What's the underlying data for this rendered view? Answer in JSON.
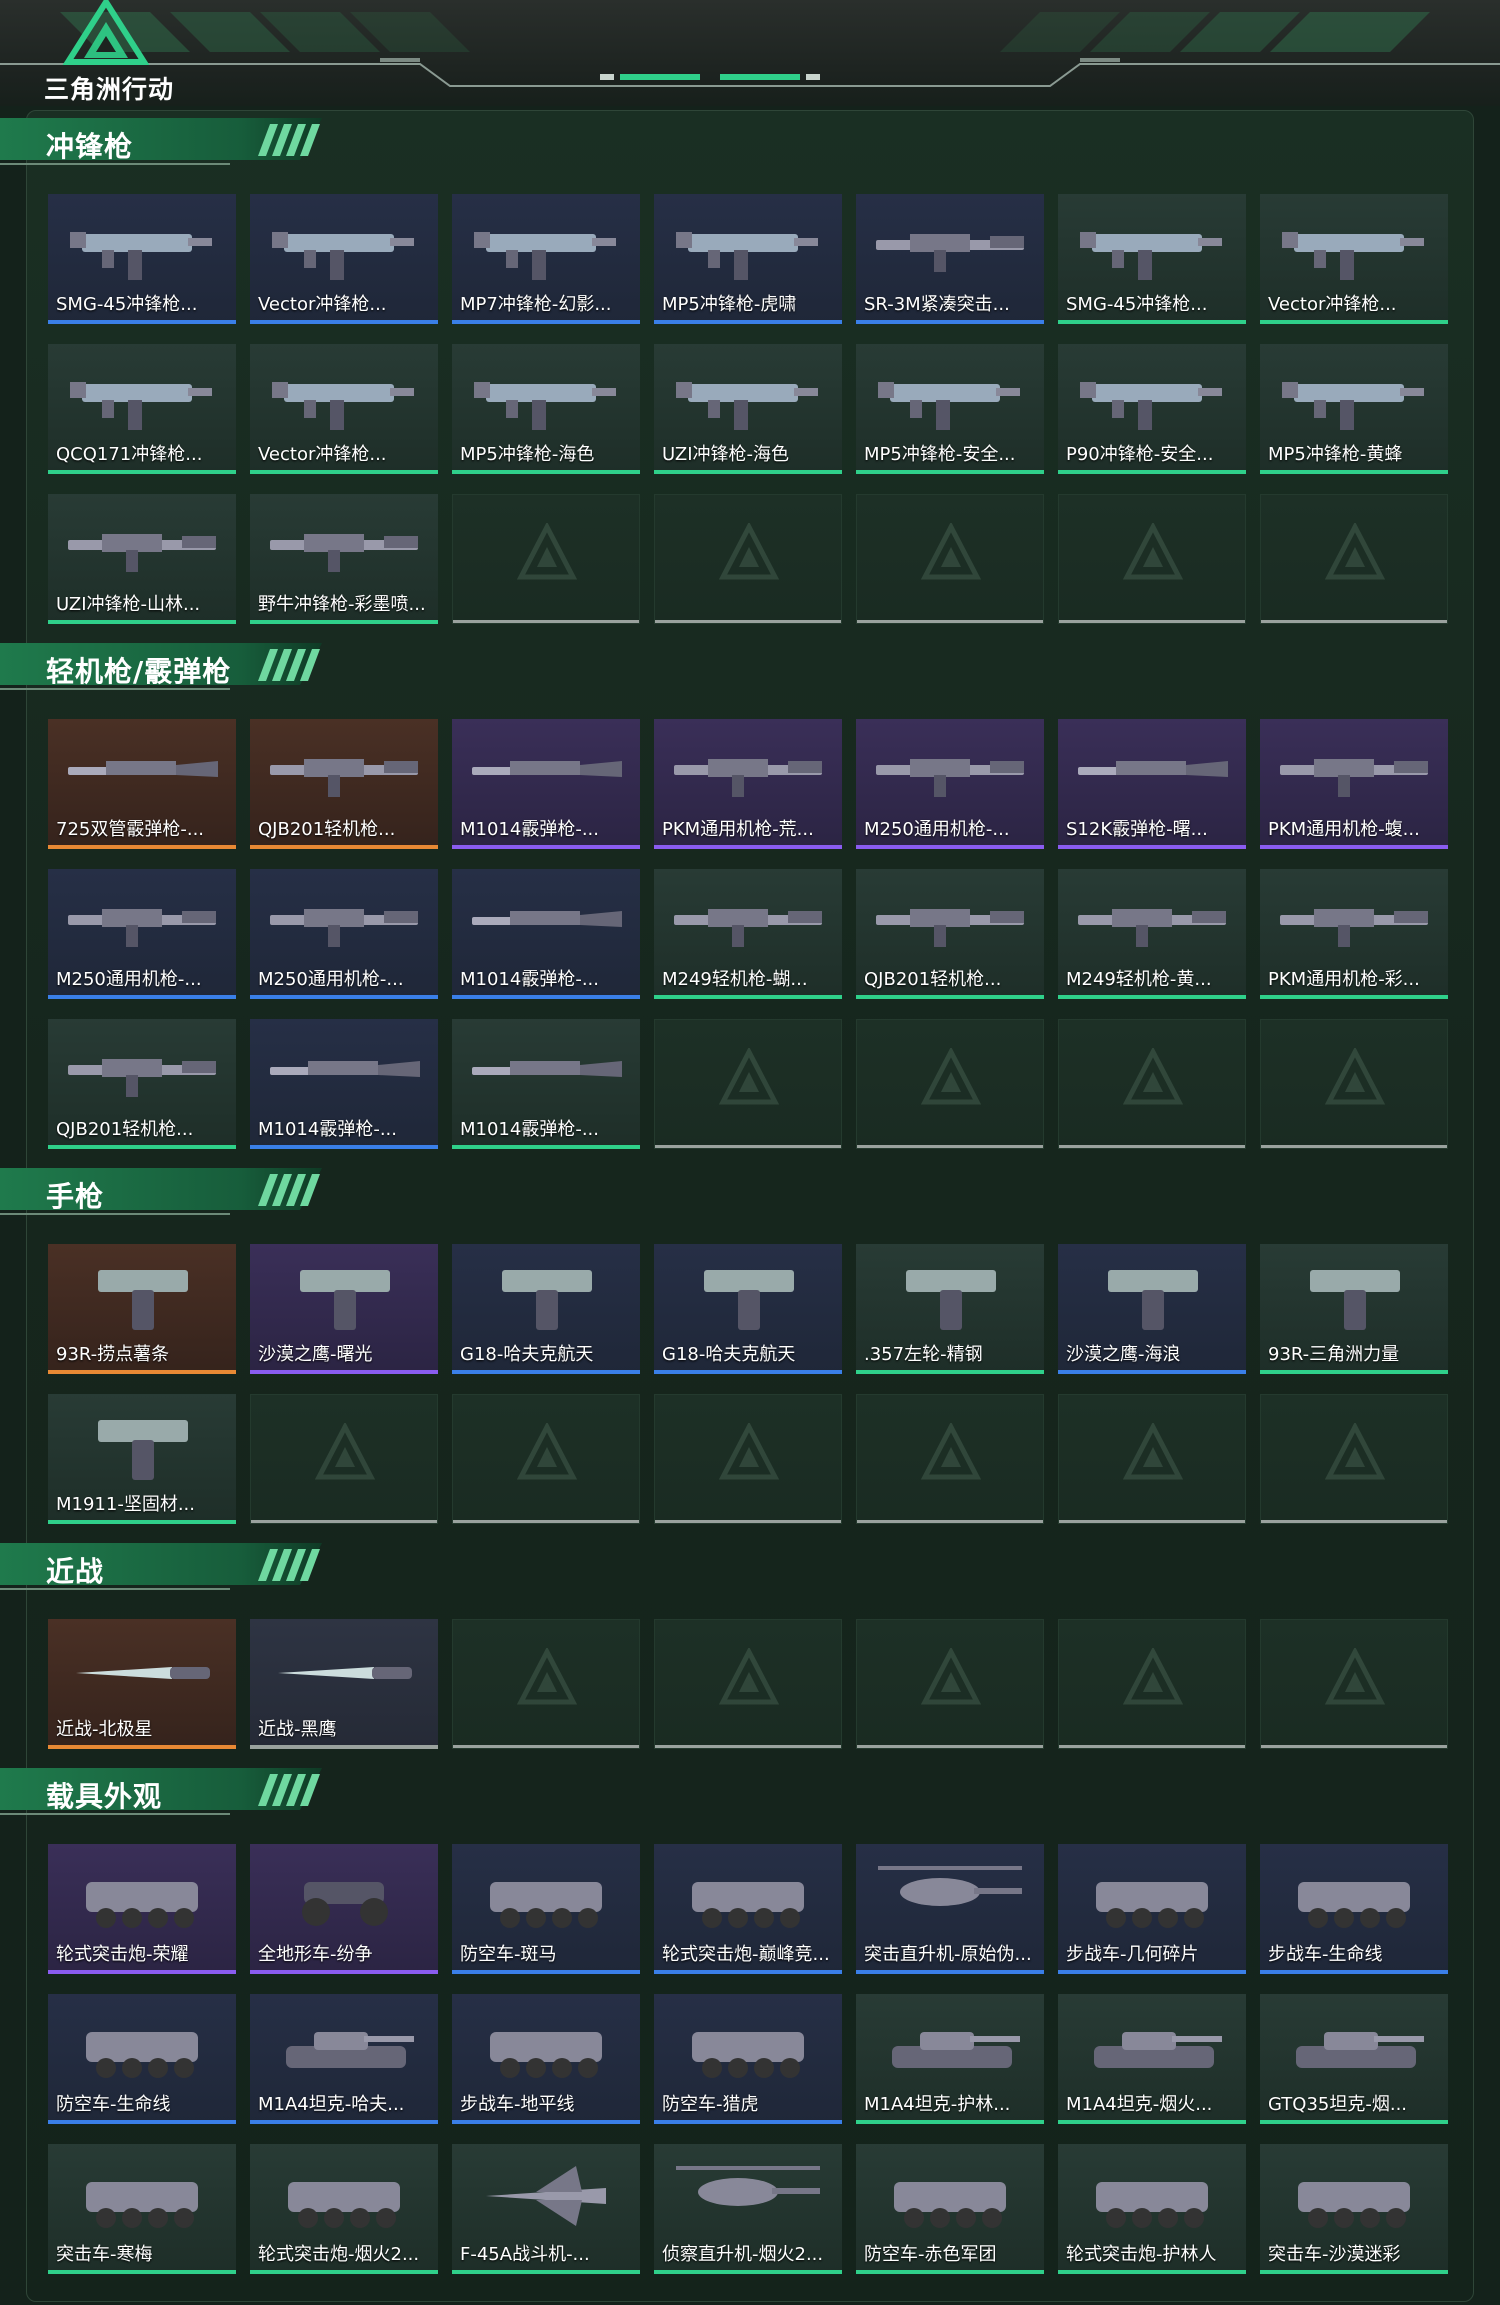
{
  "app": {
    "title": "三角洲行动"
  },
  "sections": [
    {
      "title": "冲锋枪",
      "items": [
        {
          "name": "SMG-45冲锋枪...",
          "rarity": "blue",
          "icon": "smg-icon"
        },
        {
          "name": "Vector冲锋枪...",
          "rarity": "blue",
          "icon": "smg-icon"
        },
        {
          "name": "MP7冲锋枪-幻影...",
          "rarity": "blue",
          "icon": "smg-icon"
        },
        {
          "name": "MP5冲锋枪-虎啸",
          "rarity": "blue",
          "icon": "smg-icon"
        },
        {
          "name": "SR-3M紧凑突击...",
          "rarity": "blue",
          "icon": "rifle-icon"
        },
        {
          "name": "SMG-45冲锋枪...",
          "rarity": "green",
          "icon": "smg-icon"
        },
        {
          "name": "Vector冲锋枪...",
          "rarity": "green",
          "icon": "smg-icon"
        },
        {
          "name": "QCQ171冲锋枪...",
          "rarity": "green",
          "icon": "smg-icon"
        },
        {
          "name": "Vector冲锋枪...",
          "rarity": "green",
          "icon": "smg-icon"
        },
        {
          "name": "MP5冲锋枪-海色",
          "rarity": "green",
          "icon": "smg-icon"
        },
        {
          "name": "UZI冲锋枪-海色",
          "rarity": "green",
          "icon": "smg-icon"
        },
        {
          "name": "MP5冲锋枪-安全...",
          "rarity": "green",
          "icon": "smg-icon"
        },
        {
          "name": "P90冲锋枪-安全...",
          "rarity": "green",
          "icon": "smg-icon"
        },
        {
          "name": "MP5冲锋枪-黄蜂",
          "rarity": "green",
          "icon": "smg-icon"
        },
        {
          "name": "UZI冲锋枪-山林...",
          "rarity": "green",
          "icon": "rifle-icon"
        },
        {
          "name": "野牛冲锋枪-彩墨喷...",
          "rarity": "green",
          "icon": "rifle-icon"
        }
      ],
      "empty": 5
    },
    {
      "title": "轻机枪/霰弹枪",
      "items": [
        {
          "name": "725双管霰弹枪-...",
          "rarity": "orange",
          "icon": "shotgun-icon"
        },
        {
          "name": "QJB201轻机枪...",
          "rarity": "orange",
          "icon": "lmg-icon"
        },
        {
          "name": "M1014霰弹枪-...",
          "rarity": "purple",
          "icon": "shotgun-icon"
        },
        {
          "name": "PKM通用机枪-荒...",
          "rarity": "purple",
          "icon": "lmg-icon"
        },
        {
          "name": "M250通用机枪-...",
          "rarity": "purple",
          "icon": "lmg-icon"
        },
        {
          "name": "S12K霰弹枪-曙...",
          "rarity": "purple",
          "icon": "shotgun-icon"
        },
        {
          "name": "PKM通用机枪-蝮...",
          "rarity": "purple",
          "icon": "lmg-icon"
        },
        {
          "name": "M250通用机枪-...",
          "rarity": "blue",
          "icon": "lmg-icon"
        },
        {
          "name": "M250通用机枪-...",
          "rarity": "blue",
          "icon": "lmg-icon"
        },
        {
          "name": "M1014霰弹枪-...",
          "rarity": "blue",
          "icon": "shotgun-icon"
        },
        {
          "name": "M249轻机枪-蝴...",
          "rarity": "green",
          "icon": "lmg-icon"
        },
        {
          "name": "QJB201轻机枪...",
          "rarity": "green",
          "icon": "lmg-icon"
        },
        {
          "name": "M249轻机枪-黄...",
          "rarity": "green",
          "icon": "lmg-icon"
        },
        {
          "name": "PKM通用机枪-彩...",
          "rarity": "green",
          "icon": "lmg-icon"
        },
        {
          "name": "QJB201轻机枪...",
          "rarity": "green",
          "icon": "lmg-icon"
        },
        {
          "name": "M1014霰弹枪-...",
          "rarity": "blue",
          "icon": "shotgun-icon"
        },
        {
          "name": "M1014霰弹枪-...",
          "rarity": "green",
          "icon": "shotgun-icon"
        }
      ],
      "empty": 4
    },
    {
      "title": "手枪",
      "items": [
        {
          "name": "93R-捞点薯条",
          "rarity": "orange",
          "icon": "pistol-icon"
        },
        {
          "name": "沙漠之鹰-曙光",
          "rarity": "purple",
          "icon": "pistol-icon"
        },
        {
          "name": "G18-哈夫克航天",
          "rarity": "blue",
          "icon": "pistol-icon"
        },
        {
          "name": "G18-哈夫克航天",
          "rarity": "blue",
          "icon": "pistol-icon"
        },
        {
          "name": ".357左轮-精钢",
          "rarity": "green",
          "icon": "revolver-icon"
        },
        {
          "name": "沙漠之鹰-海浪",
          "rarity": "blue",
          "icon": "pistol-icon"
        },
        {
          "name": "93R-三角洲力量",
          "rarity": "green",
          "icon": "pistol-icon"
        },
        {
          "name": "M1911-坚固材...",
          "rarity": "green",
          "icon": "pistol-icon"
        }
      ],
      "empty": 6
    },
    {
      "title": "近战",
      "items": [
        {
          "name": "近战-北极星",
          "rarity": "orange",
          "icon": "knife-icon"
        },
        {
          "name": "近战-黑鹰",
          "rarity": "gray",
          "icon": "knife-icon"
        }
      ],
      "empty": 5
    },
    {
      "title": "载具外观",
      "items": [
        {
          "name": "轮式突击炮-荣耀",
          "rarity": "purple",
          "icon": "armored-car-icon"
        },
        {
          "name": "全地形车-纷争",
          "rarity": "purple",
          "icon": "atv-icon"
        },
        {
          "name": "防空车-斑马",
          "rarity": "blue",
          "icon": "armored-car-icon"
        },
        {
          "name": "轮式突击炮-巅峰竞...",
          "rarity": "blue",
          "icon": "armored-car-icon"
        },
        {
          "name": "突击直升机-原始伪...",
          "rarity": "blue",
          "icon": "helicopter-icon"
        },
        {
          "name": "步战车-几何碎片",
          "rarity": "blue",
          "icon": "armored-car-icon"
        },
        {
          "name": "步战车-生命线",
          "rarity": "blue",
          "icon": "armored-car-icon"
        },
        {
          "name": "防空车-生命线",
          "rarity": "blue",
          "icon": "armored-car-icon"
        },
        {
          "name": "M1A4坦克-哈夫...",
          "rarity": "blue",
          "icon": "tank-icon"
        },
        {
          "name": "步战车-地平线",
          "rarity": "blue",
          "icon": "armored-car-icon"
        },
        {
          "name": "防空车-猎虎",
          "rarity": "blue",
          "icon": "armored-car-icon"
        },
        {
          "name": "M1A4坦克-护林...",
          "rarity": "green",
          "icon": "tank-icon"
        },
        {
          "name": "M1A4坦克-烟火...",
          "rarity": "green",
          "icon": "tank-icon"
        },
        {
          "name": "GTQ35坦克-烟...",
          "rarity": "green",
          "icon": "tank-icon"
        },
        {
          "name": "突击车-寒梅",
          "rarity": "green",
          "icon": "armored-car-icon"
        },
        {
          "name": "轮式突击炮-烟火2...",
          "rarity": "green",
          "icon": "armored-car-icon"
        },
        {
          "name": "F-45A战斗机-...",
          "rarity": "green",
          "icon": "jet-icon"
        },
        {
          "name": "侦察直升机-烟火2...",
          "rarity": "green",
          "icon": "helicopter-icon"
        },
        {
          "name": "防空车-赤色军团",
          "rarity": "green",
          "icon": "armored-car-icon"
        },
        {
          "name": "轮式突击炮-护林人",
          "rarity": "green",
          "icon": "armored-car-icon"
        },
        {
          "name": "突击车-沙漠迷彩",
          "rarity": "green",
          "icon": "armored-car-icon"
        }
      ],
      "empty": 0
    }
  ],
  "colors": {
    "accent_green": "#2fd08a",
    "accent_blue": "#3a7fe8",
    "accent_purple": "#8a5cf0",
    "accent_orange": "#e88934"
  }
}
